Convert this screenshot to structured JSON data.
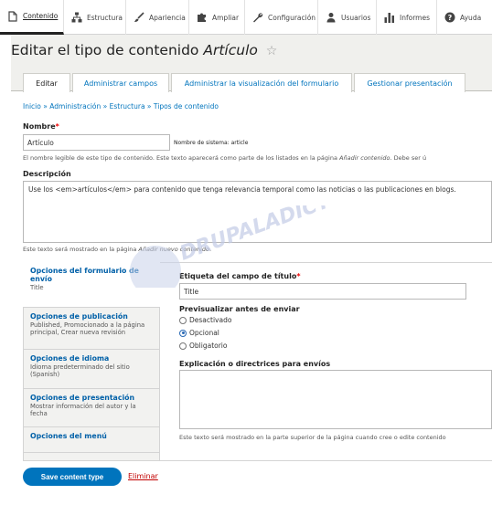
{
  "toolbar": {
    "items": [
      {
        "label": "Contenido",
        "icon": "file-icon"
      },
      {
        "label": "Estructura",
        "icon": "sitemap-icon"
      },
      {
        "label": "Apariencia",
        "icon": "brush-icon"
      },
      {
        "label": "Ampliar",
        "icon": "puzzle-icon"
      },
      {
        "label": "Configuración",
        "icon": "wrench-icon"
      },
      {
        "label": "Usuarios",
        "icon": "user-icon"
      },
      {
        "label": "Informes",
        "icon": "bar-chart-icon"
      },
      {
        "label": "Ayuda",
        "icon": "help-icon"
      }
    ]
  },
  "page": {
    "title_prefix": "Editar el tipo de contenido",
    "title_type": "Artículo",
    "star": "☆"
  },
  "tabs": [
    "Editar",
    "Administrar campos",
    "Administrar la visualización del formulario",
    "Gestionar presentación"
  ],
  "breadcrumb": "Inicio » Administración » Estructura » Tipos de contenido",
  "name_field": {
    "label": "Nombre",
    "required_mark": "*",
    "value": "Artículo",
    "machine_name": "Nombre de sistema: article",
    "help_prefix": "El nombre legible de este tipo de contenido. Este texto aparecerá como parte de los listados en la página",
    "help_em": "Añadir contenido",
    "help_suffix": ". Debe ser ú"
  },
  "description_field": {
    "label": "Descripción",
    "value": "Use los <em>artículos</em> para contenido que tenga relevancia temporal como las noticias o las publicaciones en blogs.",
    "help_prefix": "Este texto será mostrado en la página",
    "help_em": "Añadir nuevo contenido",
    "help_suffix": "."
  },
  "vertical_tabs": [
    {
      "title": "Opciones del formulario de envío",
      "summary": "Title"
    },
    {
      "title": "Opciones de publicación",
      "summary": "Published, Promocionado a la página principal, Crear nueva revisión"
    },
    {
      "title": "Opciones de idioma",
      "summary": "Idioma predeterminado del sitio (Spanish)"
    },
    {
      "title": "Opciones de presentación",
      "summary": "Mostrar información del autor y la fecha"
    },
    {
      "title": "Opciones del menú",
      "summary": ""
    }
  ],
  "submission": {
    "title_label": "Etiqueta del campo de título",
    "required_mark": "*",
    "title_value": "Title",
    "preview_label": "Previsualizar antes de enviar",
    "preview_options": [
      "Desactivado",
      "Opcional",
      "Obligatorio"
    ],
    "preview_selected": "Opcional",
    "guidelines_label": "Explicación o directrices para envíos",
    "guidelines_help": "Este texto será mostrado en la parte superior de la página cuando cree o edite contenido"
  },
  "actions": {
    "save": "Save content type",
    "delete": "Eliminar"
  },
  "watermark": "DRUPALADICTO"
}
